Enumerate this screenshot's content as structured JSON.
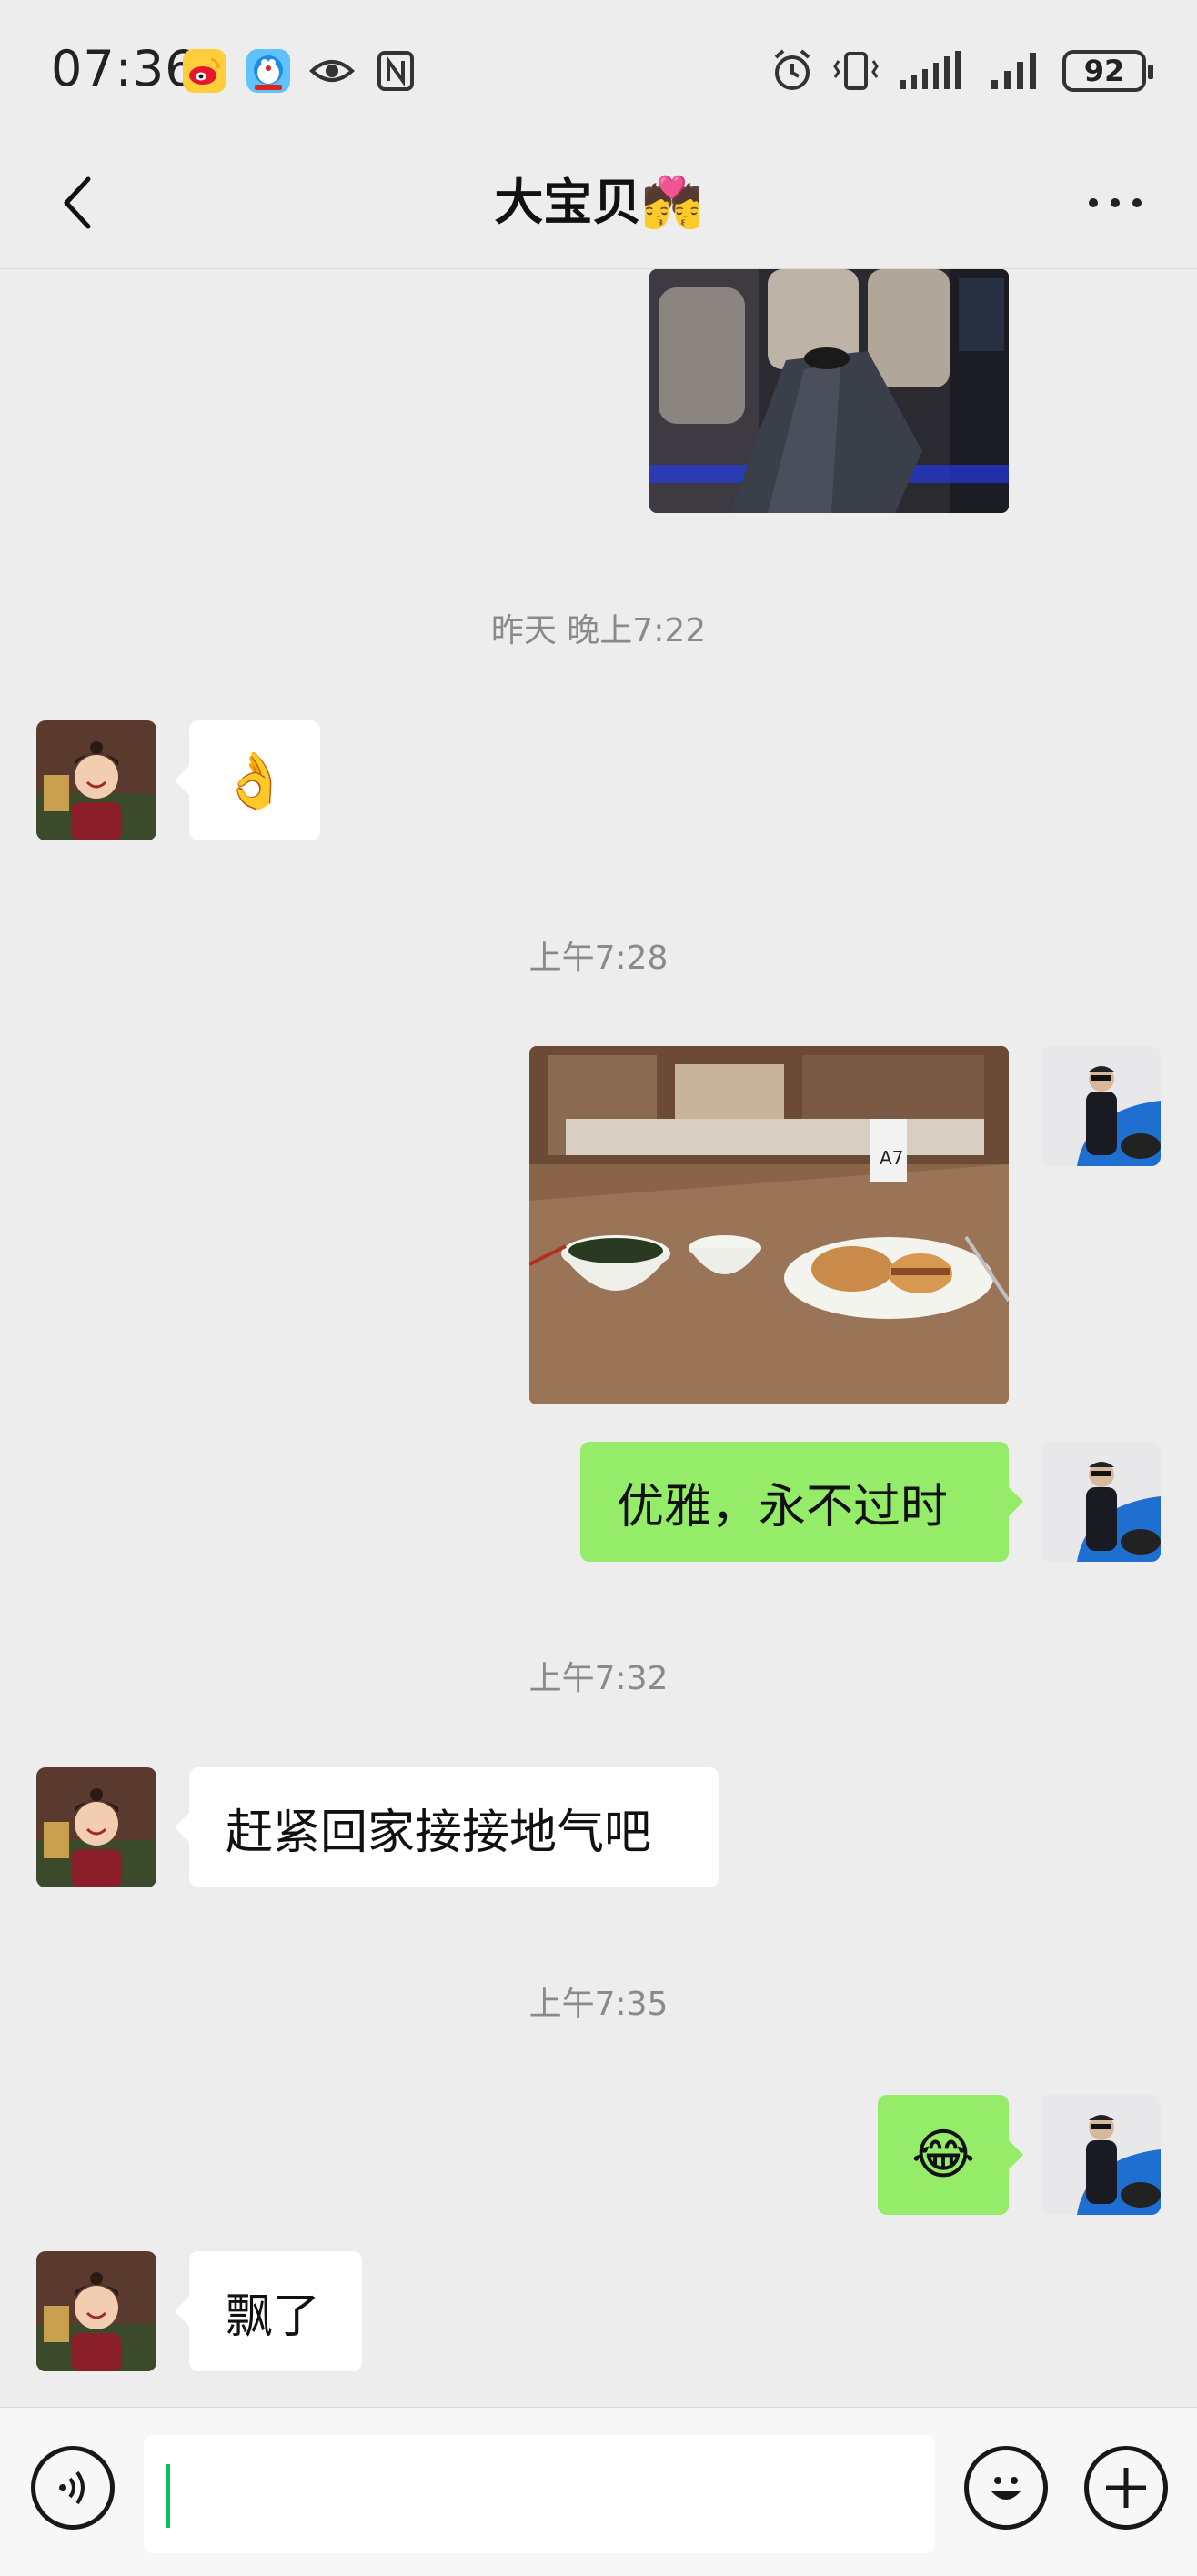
{
  "status_bar": {
    "time": "07:36",
    "battery": "92",
    "icons": [
      "weibo-icon",
      "doraemon-app-icon",
      "eye-icon",
      "nfc-icon",
      "alarm-icon",
      "vibrate-icon",
      "signal-icon",
      "signal-icon"
    ]
  },
  "header": {
    "title": "大宝贝💏"
  },
  "messages": [
    {
      "type": "image",
      "sender": "me",
      "desc": "car-seat-photo"
    },
    {
      "type": "timestamp",
      "text": "昨天 晚上7:22"
    },
    {
      "type": "emoji",
      "sender": "other",
      "text": "👌"
    },
    {
      "type": "timestamp",
      "text": "上午7:28"
    },
    {
      "type": "image",
      "sender": "me",
      "desc": "breakfast-photo"
    },
    {
      "type": "text",
      "sender": "me",
      "text": "优雅，永不过时"
    },
    {
      "type": "timestamp",
      "text": "上午7:32"
    },
    {
      "type": "text",
      "sender": "other",
      "text": "赶紧回家接接地气吧"
    },
    {
      "type": "timestamp",
      "text": "上午7:35"
    },
    {
      "type": "emoji",
      "sender": "me",
      "text": "😂"
    },
    {
      "type": "text",
      "sender": "other",
      "text": "飘了"
    }
  ],
  "input": {
    "value": "",
    "placeholder": ""
  },
  "colors": {
    "background": "#ededed",
    "outgoing_bubble": "#95ec69",
    "incoming_bubble": "#ffffff",
    "caret": "#07c160"
  }
}
